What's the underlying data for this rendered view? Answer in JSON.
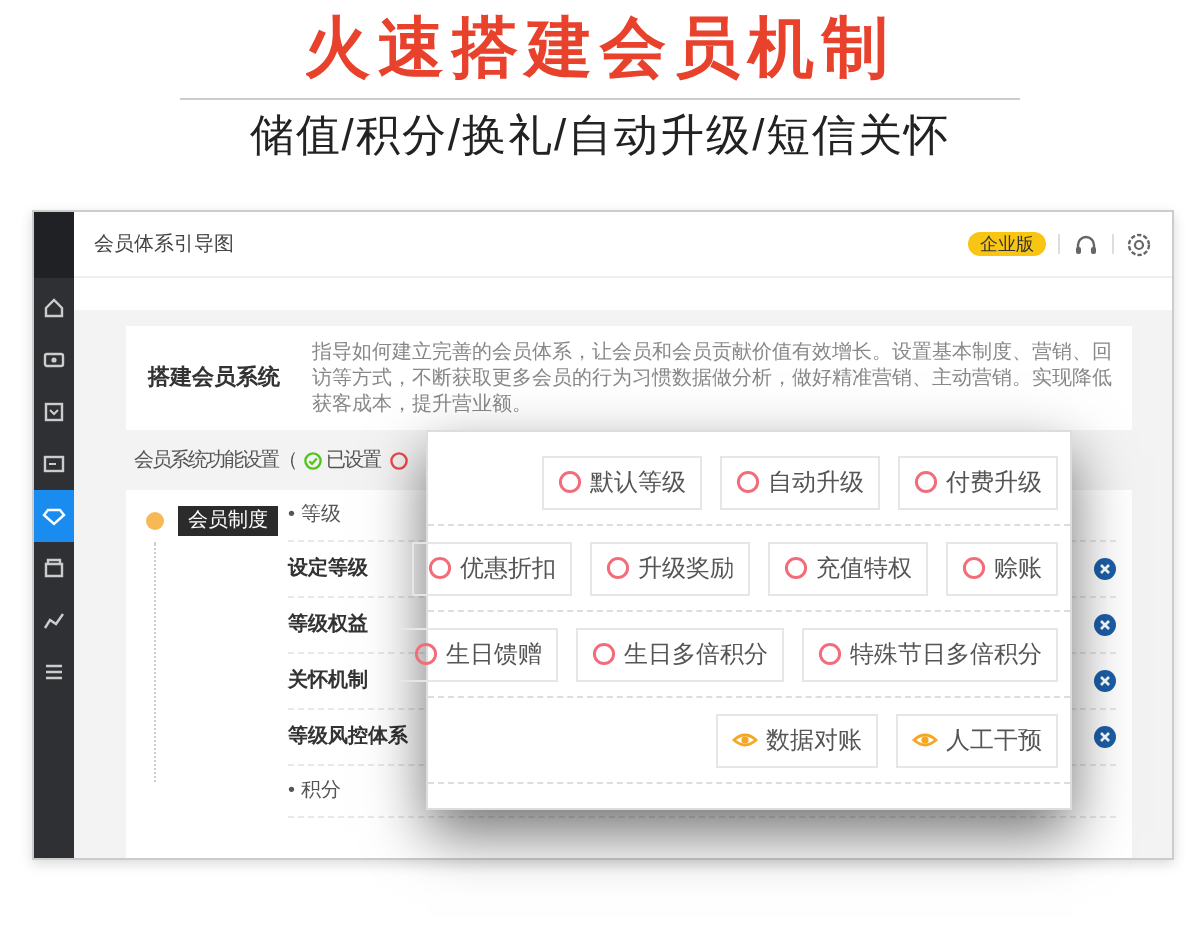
{
  "headline": "火速搭建会员机制",
  "subtitle": "储值/积分/换礼/自动升级/短信关怀",
  "app": {
    "header_title": "会员体系引导图",
    "edition_badge": "企业版",
    "sidebar": [
      {
        "kind": "home",
        "selected": false
      },
      {
        "kind": "wallet",
        "selected": false
      },
      {
        "kind": "inbox",
        "selected": false
      },
      {
        "kind": "card",
        "selected": false
      },
      {
        "kind": "diamond",
        "selected": true
      },
      {
        "kind": "store",
        "selected": false
      },
      {
        "kind": "chart",
        "selected": false
      },
      {
        "kind": "sliders",
        "selected": false
      }
    ],
    "intro_card": {
      "title": "搭建会员系统",
      "description": "指导如何建立完善的会员体系，让会员和会员贡献价值有效增长。设置基本制度、营销、回访等方式，不断获取更多会员的行为习惯数据做分析，做好精准营销、主动营销。实现降低获客成本，提升营业额。"
    },
    "settings_row": {
      "label": "会员系统功能设置（",
      "legend": [
        {
          "kind": "done",
          "label": "已设置"
        },
        {
          "kind": "todo"
        }
      ]
    },
    "timeline": {
      "tooltip": "会员制度",
      "items": [
        {
          "kind": "heading",
          "label": "• 等级"
        },
        {
          "kind": "item",
          "label": "设定等级"
        },
        {
          "kind": "item",
          "label": "等级权益"
        },
        {
          "kind": "item",
          "label": "关怀机制"
        },
        {
          "kind": "item",
          "label": "等级风控体系"
        },
        {
          "kind": "heading",
          "label": "• 积分"
        }
      ]
    },
    "popup": {
      "groups": [
        {
          "chips": [
            {
              "kind": "pending",
              "label": "默认等级"
            },
            {
              "kind": "pending",
              "label": "自动升级"
            },
            {
              "kind": "pending",
              "label": "付费升级"
            }
          ]
        },
        {
          "chips": [
            {
              "kind": "pending",
              "label": "优惠折扣"
            },
            {
              "kind": "pending",
              "label": "升级奖励"
            },
            {
              "kind": "pending",
              "label": "充值特权"
            },
            {
              "kind": "pending",
              "label": "赊账"
            }
          ]
        },
        {
          "chips": [
            {
              "kind": "pending",
              "label": "生日馈赠"
            },
            {
              "kind": "pending",
              "label": "生日多倍积分"
            },
            {
              "kind": "pending",
              "label": "特殊节日多倍积分"
            }
          ]
        },
        {
          "chips": [
            {
              "kind": "view",
              "label": "数据对账"
            },
            {
              "kind": "view",
              "label": "人工干预"
            }
          ]
        }
      ]
    }
  }
}
